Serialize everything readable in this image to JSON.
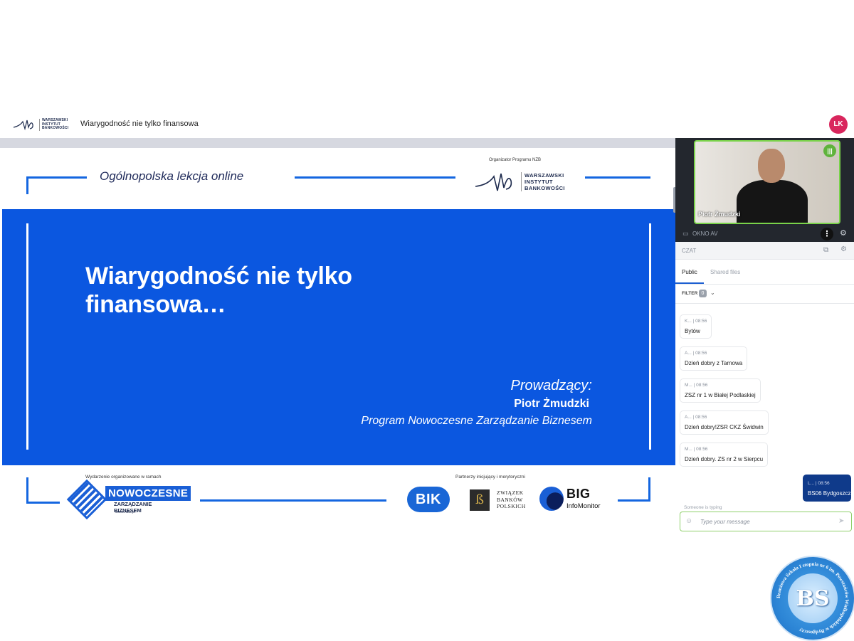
{
  "topbar": {
    "logo_lines": [
      "WARSZAWSKI",
      "INSTYTUT",
      "BANKOWOŚCI"
    ],
    "meeting_title": "Wiarygodność nie tylko finansowa",
    "user_initials": "LK",
    "avatar_color": "#d9265d"
  },
  "slide": {
    "lesson_title": "Ogólnopolska lekcja online",
    "organizer_label": "Organizator Programu NZB",
    "organizer_logo_lines": [
      "WARSZAWSKI",
      "INSTYTUT",
      "BANKOWOŚCI"
    ],
    "heading_line1": "Wiarygodność nie tylko",
    "heading_line2": "finansowa…",
    "presenter_label": "Prowadzący:",
    "presenter_name": "Piotr Żmudzki",
    "presenter_program": "Program Nowoczesne Zarządzanie Biznesem",
    "footer_org_label": "Wydarzenie organizowane w ramach",
    "nzb_name": "NOWOCZESNE",
    "nzb_sub": "ZARZĄDZANIE BIZNESEM",
    "nzb_url": "www.nzb.pl",
    "partners_label": "Partnerzy inicjujący i merytoryczni",
    "bik_label": "BIK",
    "zbp_lines": [
      "ZWIĄZEK",
      "BANKÓW",
      "POLSKICH"
    ],
    "big_label": "BIG",
    "big_sub": "InfoMonitor",
    "accent_color": "#0b57e0"
  },
  "video": {
    "participant_name": "Piotr Żmudzki",
    "window_label": "OKNO AV",
    "talking_color": "#5fb33b"
  },
  "chat": {
    "title": "CZAT",
    "tabs": [
      {
        "label": "Public",
        "active": true
      },
      {
        "label": "Shared files",
        "active": false
      }
    ],
    "filter_label": "FILTER",
    "filter_count": "0",
    "messages": [
      {
        "author": "K...",
        "time": "08:56",
        "text": "Bytów"
      },
      {
        "author": "A...",
        "time": "08:56",
        "text": "Dzień dobry z Tarnowa"
      },
      {
        "author": "M...",
        "time": "08:56",
        "text": "ZSZ nr 1 w Białej Podlaskiej"
      },
      {
        "author": "A...",
        "time": "08:56",
        "text": "Dzień dobry!ZSR CKZ Świdwin"
      },
      {
        "author": "M...",
        "time": "08:56",
        "text": "Dzień dobry. ZS nr 2 w Sierpcu"
      }
    ],
    "own_message": {
      "author": "L...",
      "time": "08:56",
      "text": "BS06 Bydgoszcz"
    },
    "typing_indicator": "Someone is typing",
    "input_placeholder": "Type your message"
  },
  "badge": {
    "initials": "BS",
    "ring_text": "Branżowa Szkoła I stopnia nr 6 im. Powstańców Wielkopolskich w Bydgoszczy"
  }
}
